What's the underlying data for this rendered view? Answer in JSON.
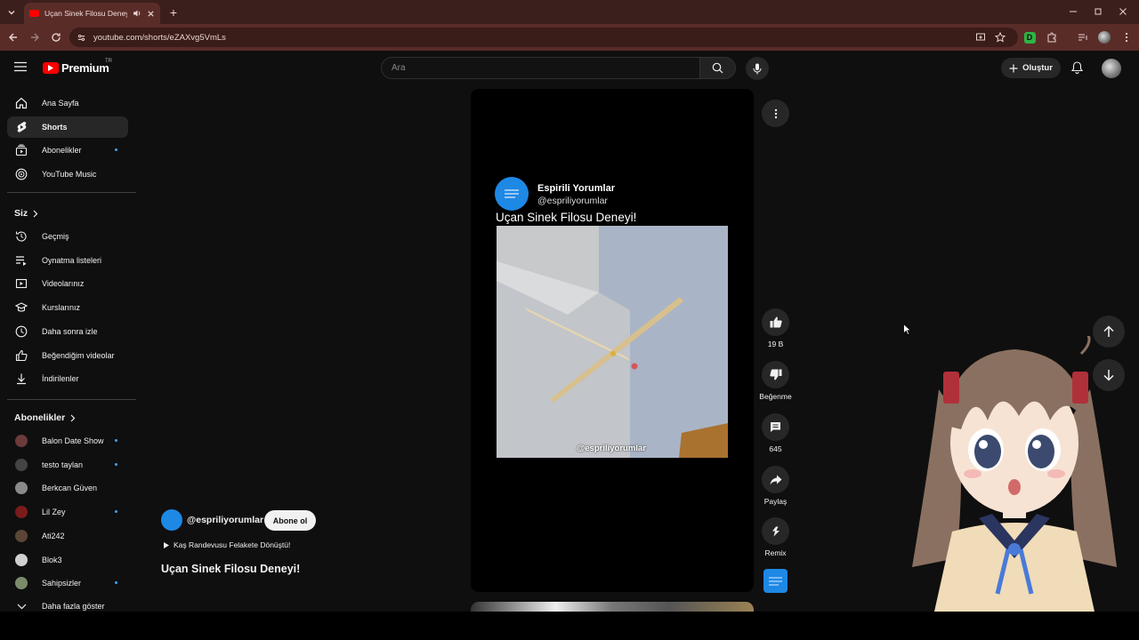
{
  "browser": {
    "tab_title": "Uçan Sinek Filosu Deneyi! -",
    "url": "youtube.com/shorts/eZAXvg5VmLs",
    "colors": {
      "tabbar": "#3b1f1c",
      "toolbar": "#5a2c28"
    }
  },
  "masthead": {
    "logo_text": "Premium",
    "region": "TR",
    "search_placeholder": "Ara",
    "create_label": "Oluştur"
  },
  "sidebar": {
    "main": [
      {
        "label": "Ana Sayfa",
        "icon": "home-icon"
      },
      {
        "label": "Shorts",
        "icon": "shorts-icon",
        "active": true
      },
      {
        "label": "Abonelikler",
        "icon": "subscriptions-icon",
        "dot": true
      },
      {
        "label": "YouTube Music",
        "icon": "music-icon"
      }
    ],
    "you_heading": "Siz",
    "you": [
      {
        "label": "Geçmiş",
        "icon": "history-icon"
      },
      {
        "label": "Oynatma listeleri",
        "icon": "playlists-icon"
      },
      {
        "label": "Videolarınız",
        "icon": "your-videos-icon"
      },
      {
        "label": "Kurslarınız",
        "icon": "courses-icon"
      },
      {
        "label": "Daha sonra izle",
        "icon": "watch-later-icon"
      },
      {
        "label": "Beğendiğim videolar",
        "icon": "liked-icon"
      },
      {
        "label": "İndirilenler",
        "icon": "downloads-icon"
      }
    ],
    "subs_heading": "Abonelikler",
    "subscriptions": [
      {
        "label": "Balon Date Show",
        "dot": true,
        "color": "#6b3a3a"
      },
      {
        "label": "testo taylan",
        "dot": true,
        "color": "#444444"
      },
      {
        "label": "Berkcan Güven",
        "dot": false,
        "color": "#8a8a8a"
      },
      {
        "label": "Lil Zey",
        "dot": true,
        "color": "#7a1c1c"
      },
      {
        "label": "Ati242",
        "dot": false,
        "color": "#5a4536"
      },
      {
        "label": "Blok3",
        "dot": false,
        "color": "#d0d0d0"
      },
      {
        "label": "Sahipsizler",
        "dot": true,
        "color": "#7c8c6a"
      }
    ],
    "show_more": "Daha fazla göster"
  },
  "short": {
    "card_channel": "Espirili Yorumlar",
    "card_handle": "@espriliyorumlar",
    "card_title": "Uçan Sinek Filosu Deneyi!",
    "watermark": "@espriliyorumlar",
    "handle": "@espriliyorumlar",
    "subscribe_label": "Abone ol",
    "music": "Kaş Randevusu Felakete Dönüştü!",
    "title": "Uçan Sinek Filosu Deneyi!"
  },
  "actions": {
    "likes": "19 B",
    "dislike": "Beğenme",
    "comments": "645",
    "share": "Paylaş",
    "remix": "Remix"
  }
}
